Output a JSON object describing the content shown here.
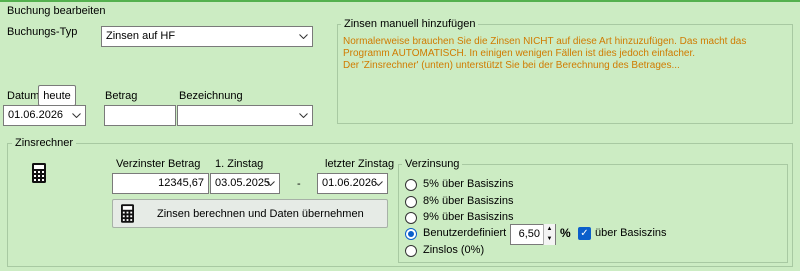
{
  "buchung": {
    "group_title": "Buchung bearbeiten",
    "typ_label": "Buchungs-Typ",
    "typ_value": "Zinsen auf HF",
    "datum_label": "Datum",
    "heute_button": "heute",
    "datum_value": "01.06.2026",
    "betrag_label": "Betrag",
    "betrag_value": "",
    "bezeichnung_label": "Bezeichnung",
    "bezeichnung_value": ""
  },
  "manuell": {
    "group_title": "Zinsen manuell hinzufügen",
    "lines": [
      "Normalerweise brauchen Sie die Zinsen NICHT auf diese Art hinzuzufügen. Das macht das",
      "Programm AUTOMATISCH. In einigen wenigen Fällen ist dies jedoch einfacher.",
      "Der 'Zinsrechner' (unten) unterstützt Sie bei der Berechnung des Betrages..."
    ]
  },
  "zinsrechner": {
    "group_title": "Zinsrechner",
    "verzinster_betrag_label": "Verzinster Betrag",
    "verzinster_betrag_value": "12345,67",
    "erster_zinstag_label": "1. Zinstag",
    "erster_zinstag_value": "03.05.2025",
    "dash": "-",
    "letzter_zinstag_label": "letzter Zinstag",
    "letzter_zinstag_value": "01.06.2026",
    "berechnen_button": "Zinsen berechnen und Daten übernehmen"
  },
  "verzinsung": {
    "group_title": "Verzinsung",
    "options": [
      {
        "label": "5% über Basiszins",
        "selected": false
      },
      {
        "label": "8% über Basiszins",
        "selected": false
      },
      {
        "label": "9% über Basiszins",
        "selected": false
      },
      {
        "label": "Benutzerdefiniert",
        "selected": true
      },
      {
        "label": "Zinslos (0%)",
        "selected": false
      }
    ],
    "custom_rate": "6,50",
    "percent_sign": "%",
    "basiszins_checkbox_label": "über Basiszins",
    "basiszins_checked": true
  },
  "colors": {
    "background": "#ccecc3",
    "note_text": "#d07b00",
    "accent": "#0b5fcb",
    "top_line": "#54b14f"
  },
  "icons": {
    "calculator": "calculator-icon",
    "dropdown": "chevron-down-icon",
    "spin_up": "spin-up-icon",
    "spin_down": "spin-down-icon"
  }
}
